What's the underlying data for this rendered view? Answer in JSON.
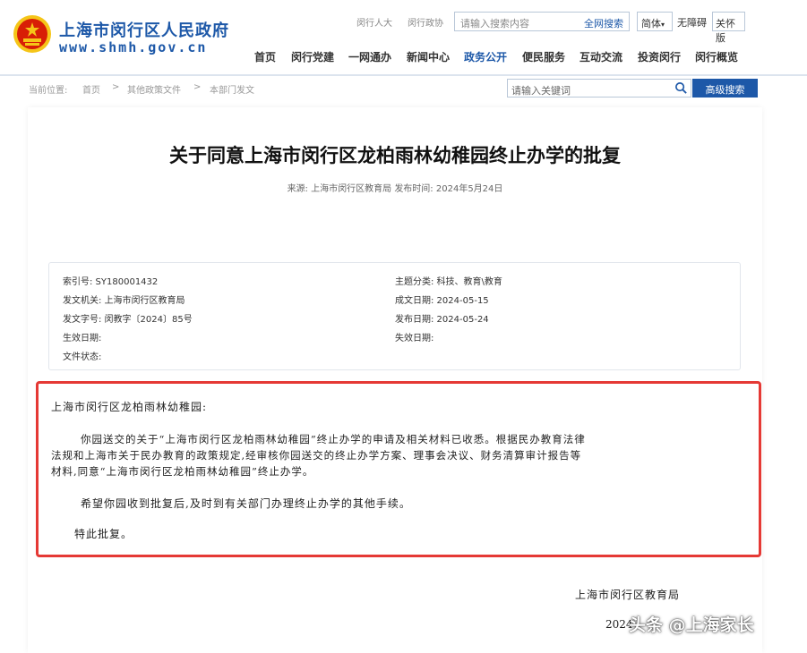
{
  "header": {
    "site_title": "上海市闵行区人民政府",
    "site_url": "www.shmh.gov.cn",
    "top_links": [
      "闵行人大",
      "闵行政协"
    ],
    "search_placeholder": "请输入搜索内容",
    "search_button": "全网搜索",
    "lang": "简体",
    "accessibility": "无障碍",
    "care_mode": "关怀版",
    "nav": [
      "首页",
      "闵行党建",
      "一网通办",
      "新闻中心",
      "政务公开",
      "便民服务",
      "互动交流",
      "投资闵行",
      "闵行概览"
    ],
    "active_nav": "政务公开"
  },
  "breadcrumb": {
    "label": "当前位置:",
    "items": [
      "首页",
      "其他政策文件",
      "本部门发文"
    ],
    "separator": ">"
  },
  "keyword_search": {
    "placeholder": "请输入关键词",
    "advanced_button": "高级搜索"
  },
  "article": {
    "title": "关于同意上海市闵行区龙柏雨林幼稚园终止办学的批复",
    "source_label": "来源:",
    "source": "上海市闵行区教育局",
    "publish_label": "发布时间:",
    "publish_date": "2024年5月24日"
  },
  "info": {
    "index_no": "索引号:  SY180001432",
    "issuer": "发文机关:  上海市闵行区教育局",
    "doc_no": "发文字号:  闵教字〔2024〕85号",
    "effective": "生效日期:",
    "status": "文件状态:",
    "category": "主题分类:  科技、教育\\教育",
    "written_date": "成文日期:  2024-05-15",
    "release_date": "发布日期:  2024-05-24",
    "expiry": "失效日期:"
  },
  "letter": {
    "salutation": "上海市闵行区龙柏雨林幼稚园:",
    "para1_line1": "你园送交的关于“上海市闵行区龙柏雨林幼稚园”终止办学的申请及相关材料已收悉。根据民办教育法律",
    "para1_line2": "法规和上海市关于民办教育的政策规定,经审核你园送交的终止办学方案、理事会决议、财务清算审计报告等",
    "para1_line3": "材料,同意“上海市闵行区龙柏雨林幼稚园”终止办学。",
    "para2": "希望你园收到批复后,及时到有关部门办理终止办学的其他手续。",
    "para3": "特此批复。",
    "signature": "上海市闵行区教育局",
    "date_partial": "2024"
  },
  "watermark": "头条 @上海家长",
  "colors": {
    "brand_blue": "#1d58a8",
    "highlight_red": "#e53935",
    "emblem_red": "#d81e06",
    "emblem_gold": "#f5c518"
  }
}
